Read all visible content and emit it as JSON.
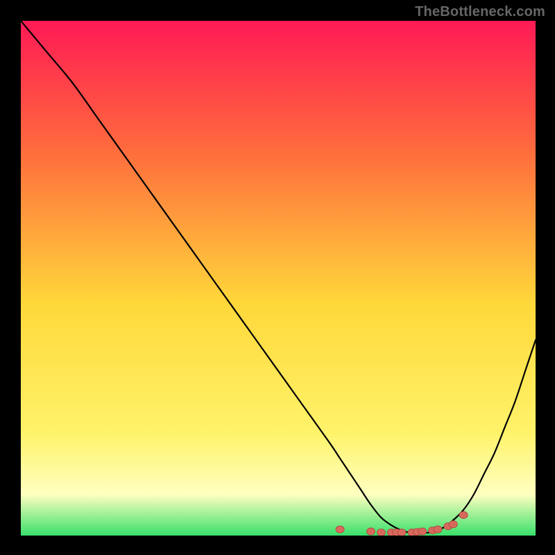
{
  "watermark": {
    "text": "TheBottleneck.com"
  },
  "colors": {
    "page_bg": "#000000",
    "grad_top": "#ff1a55",
    "grad_mid_upper": "#ff6b3d",
    "grad_mid": "#ffd83a",
    "grad_lower": "#fff36a",
    "grad_band": "#ffffc0",
    "grad_bottom": "#39e06b",
    "curve": "#000000",
    "marker_fill": "#d86a5d",
    "marker_stroke": "#b24d43",
    "watermark": "#666666"
  },
  "chart_data": {
    "type": "line",
    "title": "",
    "xlabel": "",
    "ylabel": "",
    "xlim": [
      0,
      100
    ],
    "ylim": [
      0,
      100
    ],
    "grid": false,
    "legend": false,
    "x": [
      0,
      5,
      10,
      15,
      20,
      25,
      30,
      35,
      40,
      45,
      50,
      55,
      60,
      62,
      64,
      66,
      68,
      70,
      72,
      74,
      76,
      78,
      80,
      82,
      84,
      86,
      88,
      90,
      92,
      94,
      96,
      98,
      100
    ],
    "values": [
      100,
      94,
      88,
      81,
      74,
      67,
      60,
      53,
      46,
      39,
      32,
      25,
      18,
      15,
      12,
      9,
      6,
      3.5,
      2,
      1,
      0.5,
      0.5,
      0.7,
      1.5,
      3,
      5,
      8,
      12,
      16,
      21,
      26,
      32,
      38
    ],
    "markers": {
      "x": [
        62,
        68,
        70,
        72,
        73,
        74,
        76,
        77,
        78,
        80,
        81,
        83,
        84,
        86
      ],
      "y": [
        1.2,
        0.8,
        0.6,
        0.6,
        0.6,
        0.6,
        0.6,
        0.7,
        0.8,
        1.0,
        1.2,
        1.8,
        2.2,
        4.0
      ]
    },
    "background_gradient_description": "vertical rainbow gradient from red at top through orange and yellow to green at bottom indicating good-to-bad regions"
  }
}
